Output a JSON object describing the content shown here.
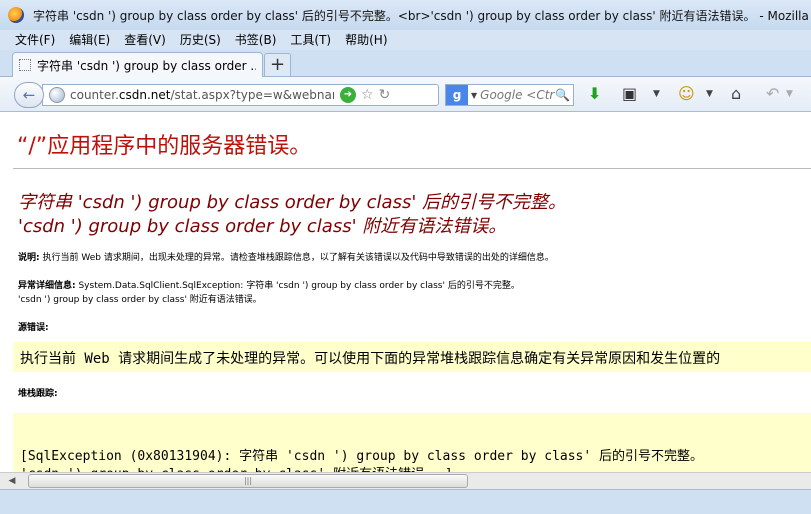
{
  "window": {
    "title": "字符串 'csdn ') group by class order by class' 后的引号不完整。<br>'csdn ') group by class order by class' 附近有语法错误。 - Mozilla Fir"
  },
  "menu": [
    "文件(F)",
    "编辑(E)",
    "查看(V)",
    "历史(S)",
    "书签(B)",
    "工具(T)",
    "帮助(H)"
  ],
  "tab": {
    "label": "字符串 'csdn ') group by class order ...",
    "new_tab": "+"
  },
  "nav": {
    "back": "←",
    "url_prefix": "counter.",
    "url_host": "csdn.net",
    "url_rest": "/stat.aspx?type=w&webname=cs",
    "search_engine": "g",
    "search_placeholder": "Google <Ctrl",
    "search_icon": "🔍",
    "icons": [
      "green-arrow-go-icon",
      "star-icon",
      "reload-icon",
      "download-icon",
      "screenshot-icon",
      "smiley-icon",
      "home-icon",
      "undo-icon"
    ]
  },
  "page": {
    "heading": "“/”应用程序中的服务器错误。",
    "error_line1_a": "字符串 ",
    "error_line1_q": "'csdn ') group by class order by class'",
    "error_line1_b": " 后的引号不完整。",
    "error_line2_q": "'csdn ') group by class order by class'",
    "error_line2_b": " 附近有语法错误。",
    "desc_label": "说明:",
    "desc_text": " 执行当前 Web 请求期间，出现未处理的异常。请检查堆栈跟踪信息，以了解有关该错误以及代码中导致错误的出处的详细信息。",
    "exc_label": "异常详细信息:",
    "exc_text": " System.Data.SqlClient.SqlException: 字符串 'csdn ') group by class order by class' 后的引号不完整。",
    "exc_text2": "'csdn ') group by class order by class' 附近有语法错误。",
    "source_label": "源错误:",
    "source_text": "执行当前 Web 请求期间生成了未处理的异常。可以使用下面的异常堆栈跟踪信息确定有关异常原因和发生位置的",
    "stack_label": "堆栈跟踪:",
    "stack_line1": "[SqlException (0x80131904): 字符串 'csdn ') group by class order by class' 后的引号不完整。",
    "stack_line2": "'csdn ') group by class order by class' 附近有语法错误。 ]"
  },
  "scroll": {
    "left": "◀",
    "grip": "|||"
  }
}
